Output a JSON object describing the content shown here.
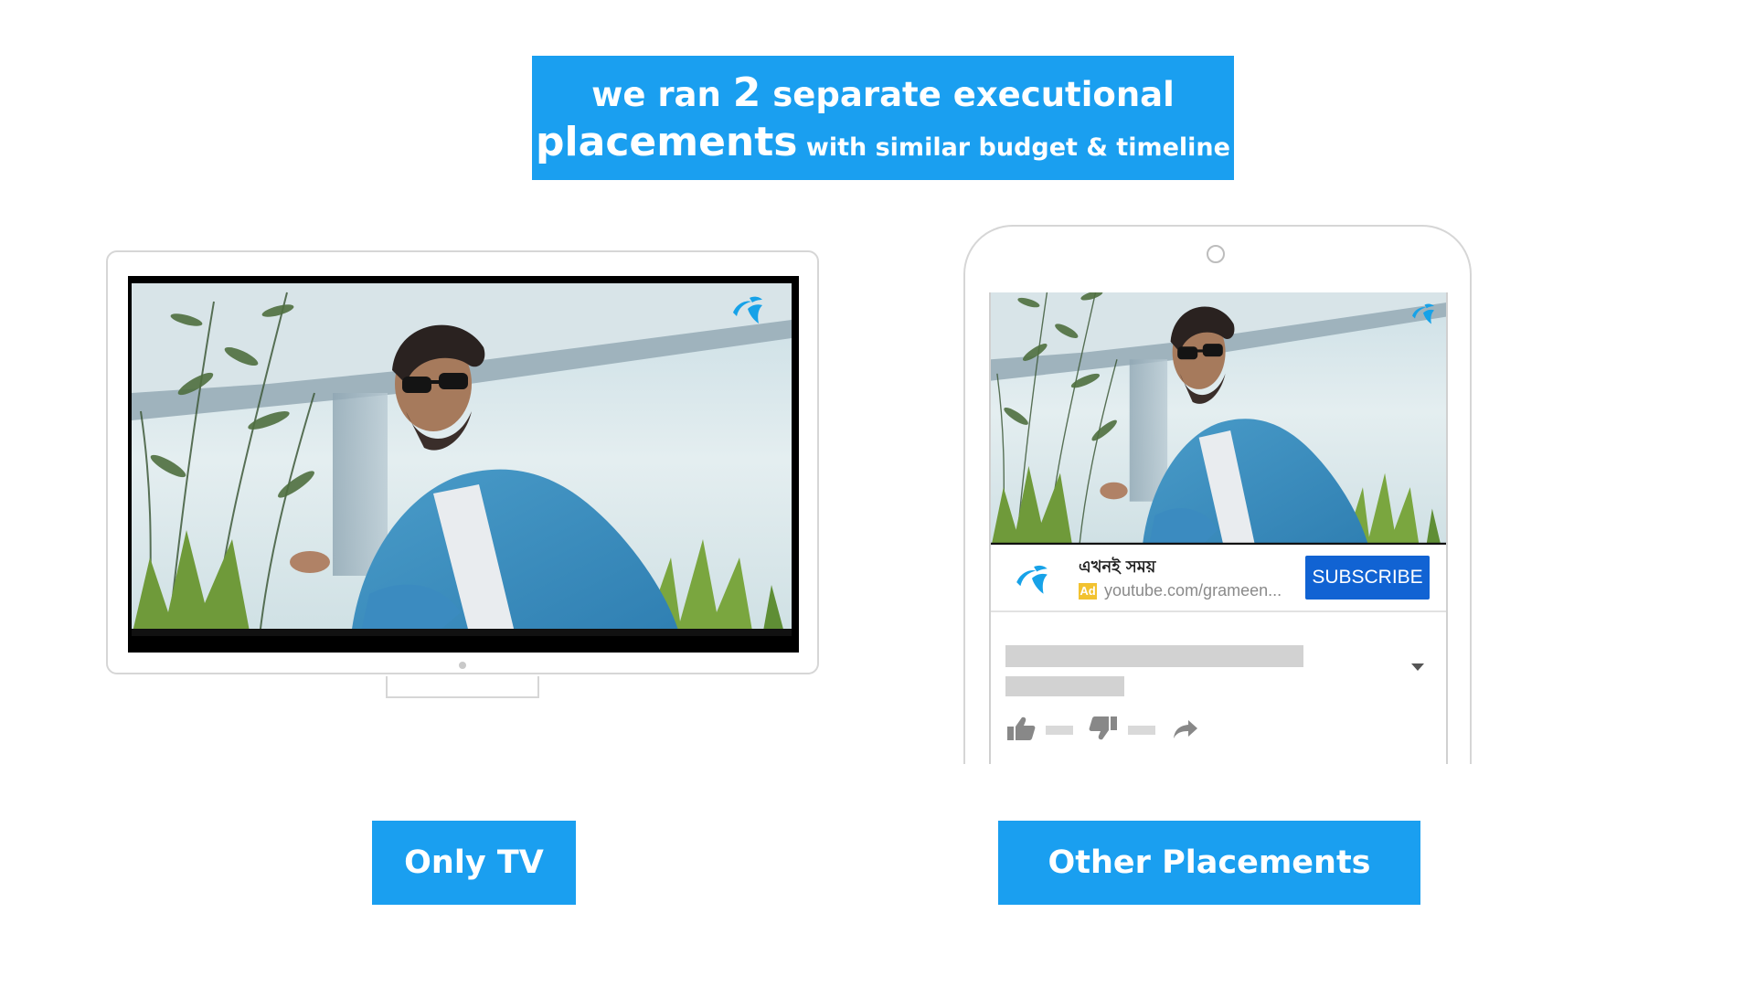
{
  "headline": {
    "line1_pre": "we ran ",
    "line1_num": "2",
    "line1_post": " separate executional",
    "line2_main": "placements",
    "line2_sub": " with similar budget & timeline"
  },
  "labels": {
    "tv": "Only TV",
    "other": "Other Placements"
  },
  "youtube_ad": {
    "title": "এখনই সময়",
    "badge": "Ad",
    "url": "youtube.com/grameen...",
    "subscribe": "SUBSCRIBE"
  },
  "icons": [
    "telenor-logo-icon",
    "thumbs-up-icon",
    "thumbs-down-icon",
    "share-icon",
    "chevron-down-icon"
  ],
  "colors": {
    "brand_blue": "#1a9ff0",
    "subscribe_blue": "#1163d3",
    "ad_badge": "#f2c230"
  }
}
